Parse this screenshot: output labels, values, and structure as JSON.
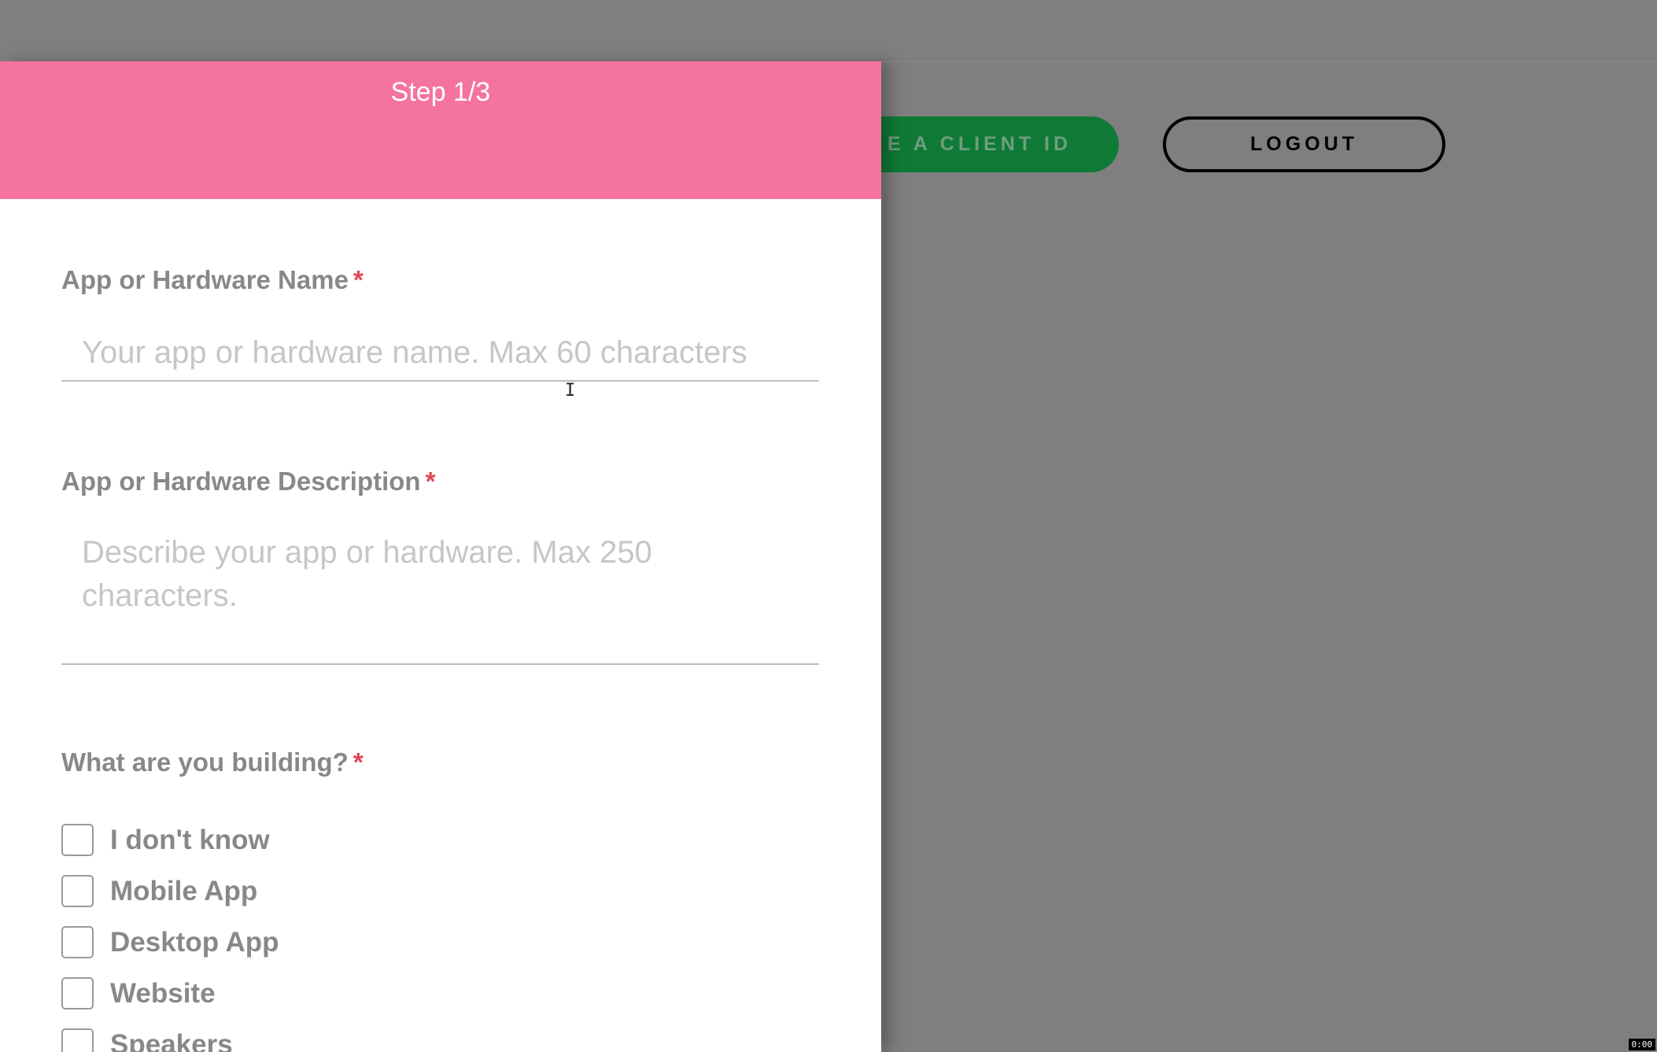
{
  "header": {
    "create_button_label": "E A CLIENT ID",
    "logout_label": "LOGOUT"
  },
  "modal": {
    "step": "Step 1/3",
    "name_field": {
      "label": "App or Hardware Name",
      "required_mark": "*",
      "value": "",
      "placeholder": "Your app or hardware name. Max 60 characters"
    },
    "description_field": {
      "label": "App or Hardware Description",
      "required_mark": "*",
      "value": "",
      "placeholder": "Describe your app or hardware. Max 250 characters."
    },
    "building_field": {
      "label": "What are you building?",
      "required_mark": "*",
      "options": [
        {
          "label": "I don't know",
          "checked": false
        },
        {
          "label": "Mobile App",
          "checked": false
        },
        {
          "label": "Desktop App",
          "checked": false
        },
        {
          "label": "Website",
          "checked": false
        },
        {
          "label": "Speakers",
          "checked": false
        }
      ]
    }
  },
  "overlay": {
    "timer": "0:00"
  },
  "colors": {
    "header_pink": "#f573a0",
    "create_button_green": "#0f7a36",
    "required_red": "#e0454f",
    "backdrop_gray": "#7f7f7f"
  }
}
